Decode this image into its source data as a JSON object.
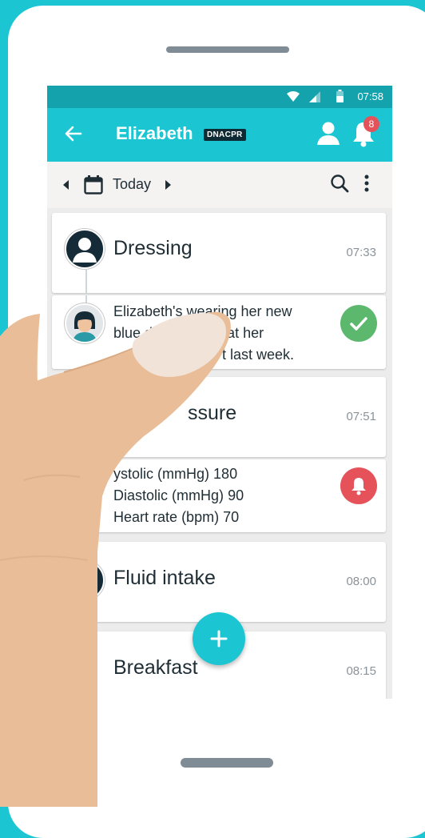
{
  "status_bar": {
    "time": "07:58"
  },
  "app_bar": {
    "title": "Elizabeth",
    "tag": "DNACPR",
    "notification_count": "8"
  },
  "date_nav": {
    "label": "Today"
  },
  "cards": [
    {
      "title": "Dressing",
      "time": "07:33",
      "lines": [
        "Elizabeth's wearing her new",
        "blue d",
        "that her",
        "t last week."
      ],
      "status": "done"
    },
    {
      "title": "ssure",
      "time": "07:51",
      "readings": [
        {
          "label": "ystolic",
          "unit": "(mmHg)",
          "value": "180"
        },
        {
          "label": "Diastolic",
          "unit": "(mmHg)",
          "value": "90"
        },
        {
          "label": "Heart rate",
          "unit": "(bpm)",
          "value": "70"
        }
      ],
      "status": "alert"
    },
    {
      "title": "Fluid intake",
      "time": "08:00"
    },
    {
      "title": "Breakfast",
      "time": "08:15"
    }
  ],
  "colors": {
    "primary": "#1bc6d2",
    "status_bar": "#14a3ad",
    "success": "#5bb86d",
    "alert": "#e5525a",
    "skin": "#e8bd98",
    "dark": "#1f2d35"
  }
}
